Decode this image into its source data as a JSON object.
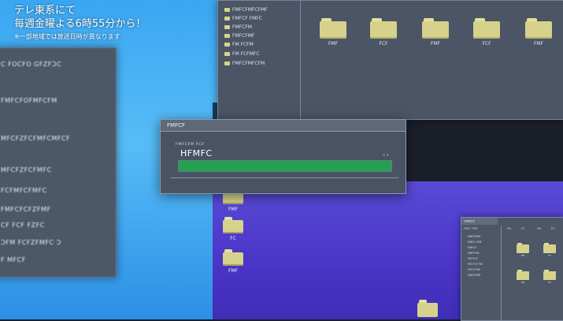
{
  "broadcast": {
    "line1": "テレ東系にて",
    "line2": "毎週金曜よる6時55分から！",
    "note": "※一部地域では放送日時が異なります"
  },
  "left_panel": {
    "items": [
      "ꓚ ꓝꓳꓚꓝꓳ ꓖꓝꓜꓝꓛꓚ",
      "ꓝꓟꓝꓚꓝꓳꓝꓟꓝꓚꓝꓟ",
      "ꓟꓝꓚꓝꓜꓝꓚꓝꓟꓝꓚꓟꓝꓚꓝ",
      "ꓟꓝꓚꓝꓜꓝꓚꓝꓟꓝꓚ",
      "ꓝꓚꓝꓟꓝꓚꓝꓟꓝꓚ",
      "ꓝꓟꓝꓚꓝꓚꓝꓜꓝꓟꓝ",
      "ꓚꓝ ꓝꓚꓝ ꓝꓜꓝꓚ",
      "ꓛꓝꓟ ꓝꓚꓝꓜꓝꓟꓝꓚ ꓛ",
      "ꓝ ꓟꓝꓚꓝ"
    ]
  },
  "explorer": {
    "sidebar": [
      "ꓝꓟꓝꓚꓝꓟꓝꓚꓝꓟꓝ",
      "ꓝꓟꓝꓚꓝ ꓝꓟꓝꓚ",
      "ꓝꓟꓝꓚꓝꓟ",
      "ꓝꓟꓝꓚꓝꓟꓝ",
      "ꓝꓟ ꓝꓚꓝꓟ",
      "ꓝꓟ ꓝꓚꓝꓟꓝꓚ",
      "ꓝꓟꓝꓚꓝꓟꓝꓚꓝꓟ"
    ],
    "folders": [
      "ꓝꓟꓝ",
      "ꓝꓚꓝ",
      "ꓝꓟꓝ",
      "ꓝꓚꓝ",
      "ꓝꓟꓝ"
    ]
  },
  "dialog": {
    "title": "ꓝꓟꓝꓚꓝ",
    "subtitle": "ꓝꓟꓝꓚꓝꓟ ꓝꓚꓝ",
    "label": "ꓧꓝꓟꓝꓚ",
    "controls": "« »",
    "progress": 1.0
  },
  "desktop_icons": [
    "ꓝꓟꓝ",
    "ꓝꓚ",
    "ꓝꓟꓝ"
  ],
  "mini_window": {
    "title": "ꓝꓟꓝꓚꓝ",
    "side_head": "ꓝꓟꓝꓚ ꓝꓟꓝ",
    "tabs": [
      "ꓝꓟ",
      "ꓝꓚ",
      "ꓝꓟ",
      "ꓝꓚ"
    ],
    "sidebar": [
      "ꓝꓟꓝꓚꓝꓟꓝ",
      "ꓝꓟꓝꓚ ꓝꓟꓝ",
      "ꓝꓟꓝꓚꓝ",
      "ꓝꓟꓝꓚꓝꓟ",
      "ꓝꓟ ꓝꓚꓝ",
      "ꓝꓟ ꓝꓚꓝ ꓝꓟ",
      "ꓝꓟ ꓝꓚꓝꓟ",
      "ꓝꓟꓝꓚꓝꓟꓝ"
    ],
    "folders": [
      "ꓝꓟ",
      "ꓝꓚ",
      "ꓝꓟ",
      "ꓝꓚ"
    ]
  },
  "colors": {
    "panel": "#4b5565",
    "progress": "#20a24e",
    "folder": "#d6d28b",
    "sky": "#3aa6f2",
    "violet": "#4b36c8"
  }
}
